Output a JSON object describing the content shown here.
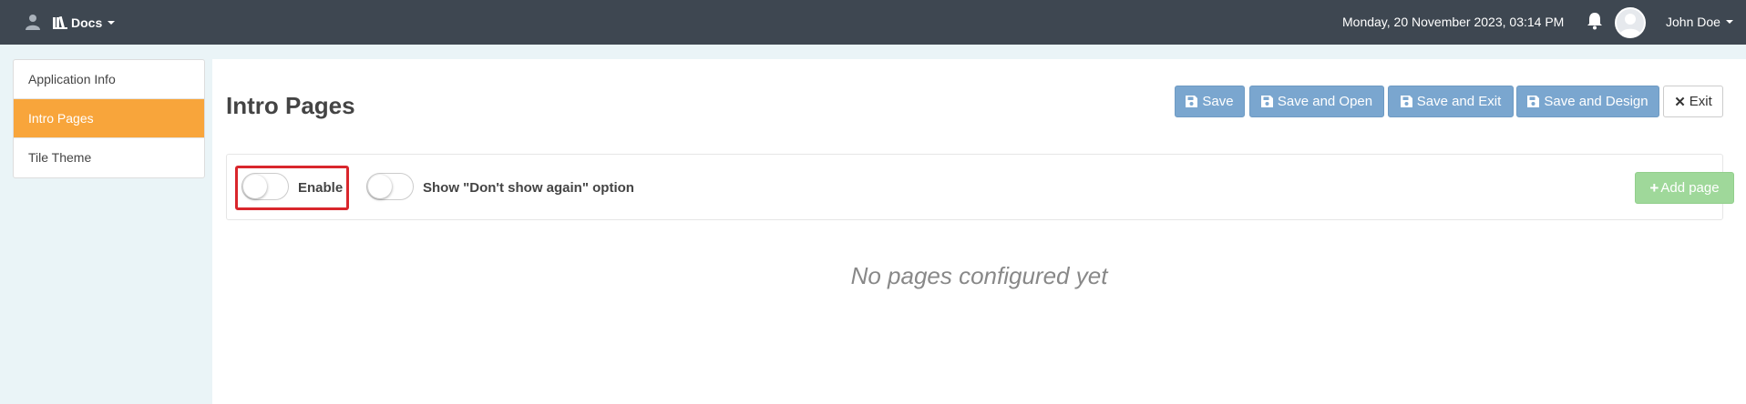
{
  "navbar": {
    "docs_label": "Docs",
    "datetime": "Monday, 20 November 2023, 03:14 PM",
    "username": "John Doe",
    "bg_color": "#3e4751"
  },
  "sidebar": {
    "items": [
      {
        "label": "Application Info",
        "active": false
      },
      {
        "label": "Intro Pages",
        "active": true
      },
      {
        "label": "Tile Theme",
        "active": false
      }
    ],
    "active_color": "#f8a53b"
  },
  "main": {
    "title": "Intro Pages",
    "buttons": {
      "save": "Save",
      "save_open": "Save and Open",
      "save_exit": "Save and Exit",
      "save_design": "Save and Design",
      "exit": "Exit"
    },
    "options": {
      "enable_label": "Enable",
      "enable_on": false,
      "dont_show_label": "Show \"Don't show again\" option",
      "dont_show_on": false,
      "add_page_label": "Add page"
    },
    "empty_message": "No pages configured yet"
  },
  "icons": [
    "user-icon",
    "books-icon",
    "bell-icon",
    "floppy-disk-icon",
    "close-icon",
    "plus-icon"
  ]
}
